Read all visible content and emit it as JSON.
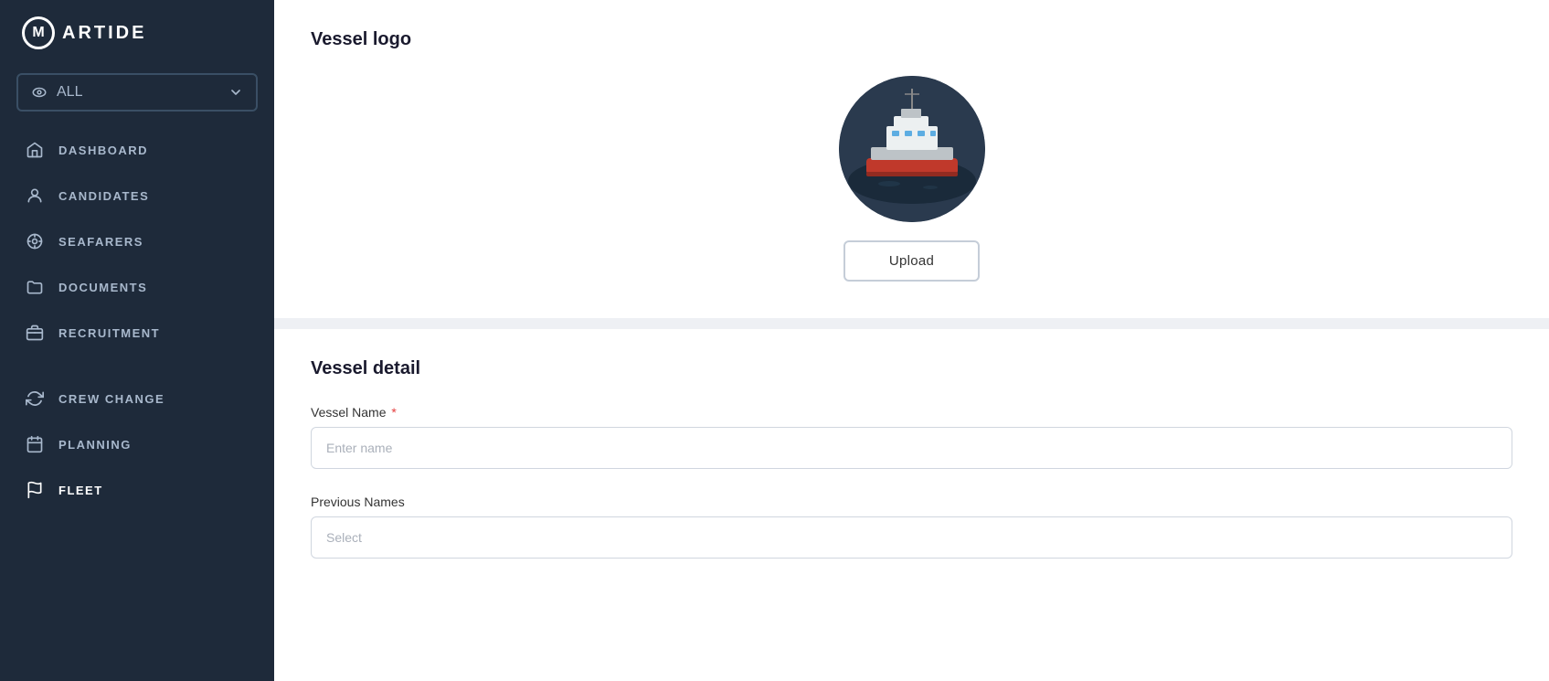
{
  "app": {
    "logo_letter": "M",
    "logo_text": "ARTIDE"
  },
  "sidebar": {
    "filter": {
      "label": "ALL",
      "eye_icon": "eye",
      "chevron_icon": "chevron-down"
    },
    "nav_items": [
      {
        "id": "dashboard",
        "label": "DASHBOARD",
        "icon": "home"
      },
      {
        "id": "candidates",
        "label": "CANDIDATES",
        "icon": "person"
      },
      {
        "id": "seafarers",
        "label": "SEAFARERS",
        "icon": "settings-circle"
      },
      {
        "id": "documents",
        "label": "DOCUMENTS",
        "icon": "folder"
      },
      {
        "id": "recruitment",
        "label": "RECRUITMENT",
        "icon": "briefcase"
      },
      {
        "id": "crew-change",
        "label": "CREW CHANGE",
        "icon": "refresh"
      },
      {
        "id": "planning",
        "label": "PLANNING",
        "icon": "calendar"
      },
      {
        "id": "fleet",
        "label": "FLEET",
        "icon": "flag"
      }
    ]
  },
  "page": {
    "vessel_logo_title": "Vessel logo",
    "upload_button_label": "Upload",
    "vessel_detail_title": "Vessel detail",
    "vessel_name_label": "Vessel Name",
    "vessel_name_placeholder": "Enter name",
    "previous_names_label": "Previous Names",
    "previous_names_placeholder": "Select"
  }
}
